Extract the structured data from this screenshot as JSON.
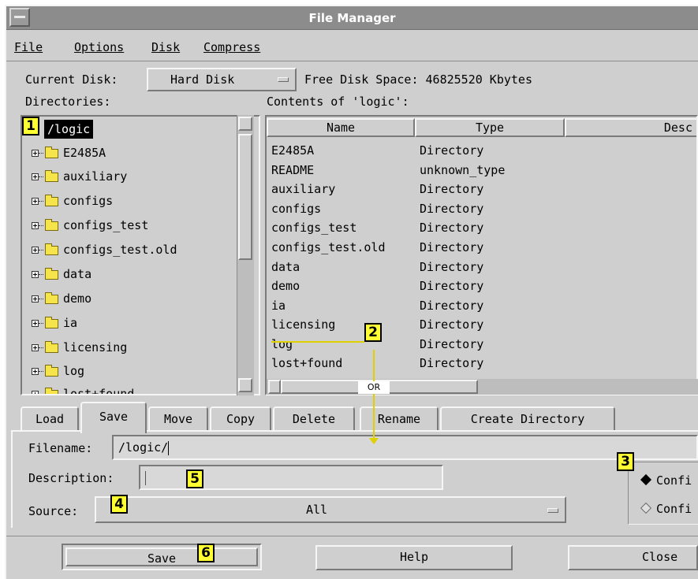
{
  "window": {
    "title": "File Manager"
  },
  "menubar": {
    "items": [
      {
        "label": "File"
      },
      {
        "label": "Options"
      },
      {
        "label": "Disk"
      },
      {
        "label": "Compress"
      }
    ]
  },
  "disk": {
    "current_label": "Current Disk:",
    "current_value": "Hard Disk",
    "free_space": "Free Disk Space: 46825520 Kbytes"
  },
  "directories": {
    "label": "Directories:",
    "root": "/logic",
    "items": [
      "E2485A",
      "auxiliary",
      "configs",
      "configs_test",
      "configs_test.old",
      "data",
      "demo",
      "ia",
      "licensing",
      "log",
      "lost+found"
    ]
  },
  "contents": {
    "label": "Contents of 'logic':",
    "columns": [
      "Name",
      "Type",
      "Desc"
    ],
    "rows": [
      {
        "name": "E2485A",
        "type": "Directory"
      },
      {
        "name": "README",
        "type": "unknown_type"
      },
      {
        "name": "auxiliary",
        "type": "Directory"
      },
      {
        "name": "configs",
        "type": "Directory"
      },
      {
        "name": "configs_test",
        "type": "Directory"
      },
      {
        "name": "configs_test.old",
        "type": "Directory"
      },
      {
        "name": "data",
        "type": "Directory"
      },
      {
        "name": "demo",
        "type": "Directory"
      },
      {
        "name": "ia",
        "type": "Directory"
      },
      {
        "name": "licensing",
        "type": "Directory"
      },
      {
        "name": "log",
        "type": "Directory"
      },
      {
        "name": "lost+found",
        "type": "Directory"
      }
    ]
  },
  "tabs": [
    "Load",
    "Save",
    "Move",
    "Copy",
    "Delete",
    "Rename",
    "Create Directory"
  ],
  "active_tab": "Save",
  "form": {
    "filename_label": "Filename:",
    "filename_value": "/logic/",
    "description_label": "Description:",
    "description_value": "",
    "source_label": "Source:",
    "source_value": "All",
    "radio_1": "Confi",
    "radio_2": "Confi"
  },
  "buttons": {
    "save": "Save",
    "help": "Help",
    "close": "Close"
  },
  "callouts": {
    "c1": "1",
    "c2": "2",
    "c3": "3",
    "c4": "4",
    "c5": "5",
    "c6": "6",
    "or": "OR"
  },
  "colors": {
    "callout": "#ffff33",
    "pointer": "#e0d000",
    "selection": "#000000"
  }
}
